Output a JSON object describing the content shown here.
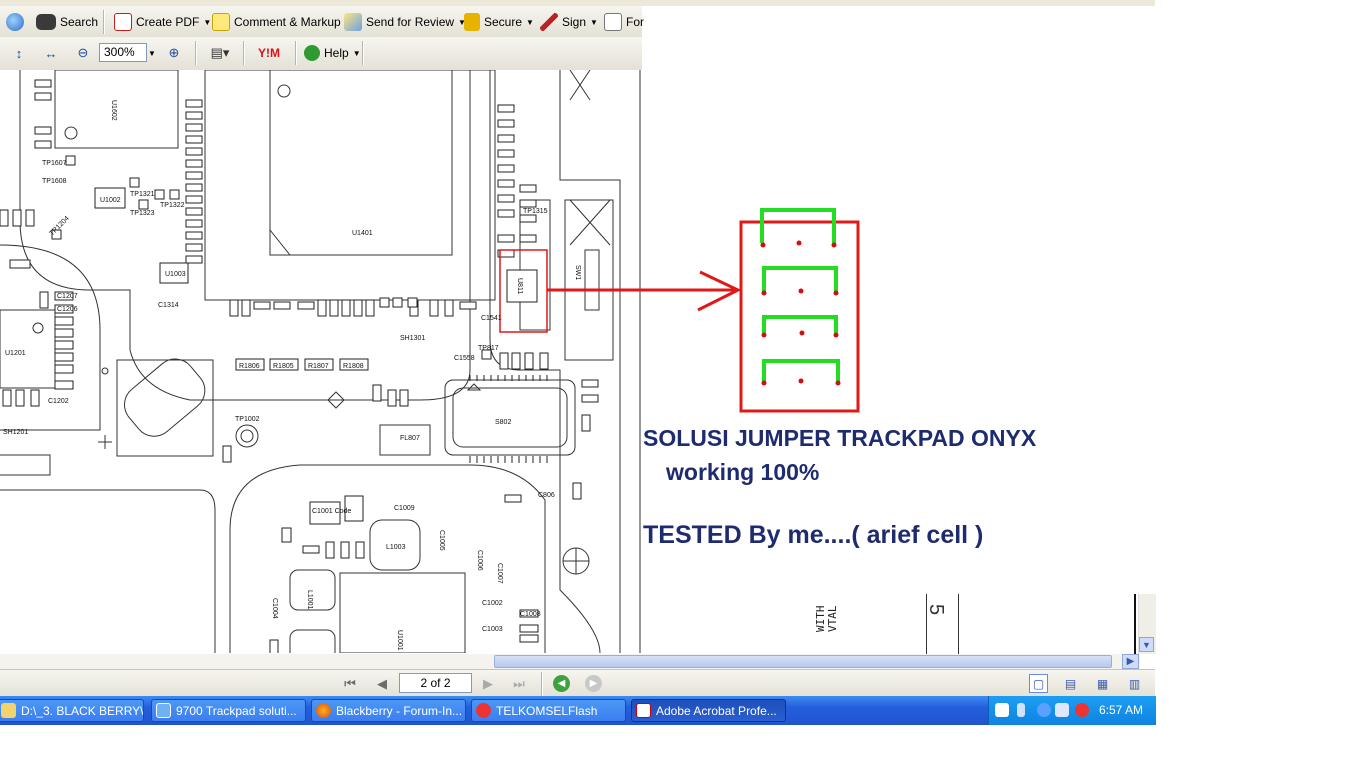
{
  "toolbar1": {
    "search_label": "Search",
    "create_pdf_label": "Create PDF",
    "comment_markup_label": "Comment & Markup",
    "send_review_label": "Send for Review",
    "secure_label": "Secure",
    "sign_label": "Sign",
    "forms_label": "For"
  },
  "toolbar2": {
    "zoom_value": "300%",
    "help_label": "Help",
    "yahoo_label": "Y!M"
  },
  "document": {
    "annotation_title": "SOLUSI JUMPER TRACKPAD ONYX",
    "annotation_line2": "working 100%",
    "annotation_line3": "TESTED By me....( arief cell )",
    "schematic_labels": {
      "u1401": "U1401",
      "u1602": "U1602",
      "u1002": "U1002",
      "u1003": "U1003",
      "u1201": "U1201",
      "c1314": "C1314",
      "sh1301": "SH1301",
      "sh1201": "SH1201",
      "s802": "S802",
      "l1003": "L1003",
      "l1001": "L1001",
      "c1001_code": "C1001 Code",
      "c1009": "C1009",
      "c1002": "C1002",
      "c1003": "C1003",
      "c806": "C806",
      "tp1002": "TP1002",
      "tp817": "TP817",
      "tp1607": "TP1607",
      "tp1608": "TP1608",
      "tp1204": "TP1204",
      "tp1321": "TP1321",
      "tp1322": "TP1322",
      "tp1323": "TP1323",
      "tp1315": "TP1315",
      "c1558": "C1558",
      "c1541": "C1541",
      "u811": "U811",
      "fl807": "FL807",
      "r1806": "R1806",
      "r1805": "R1805",
      "r1807": "R1807",
      "r1808": "R1808",
      "c1207": "C1207",
      "c1206": "C1206",
      "c1202": "C1202",
      "c1004": "C1004",
      "c1005": "C1005",
      "c1006": "C1006",
      "c1008": "C1008",
      "c1007": "C1007",
      "u1001": "U1001",
      "sw1": "SW1",
      "with_vtal": "WITH VTAL",
      "five": "5"
    }
  },
  "statusbar": {
    "page_value": "2 of 2"
  },
  "taskbar": {
    "tasks": [
      {
        "label": "D:\\_3. BLACK BERRY\\..."
      },
      {
        "label": "9700 Trackpad soluti..."
      },
      {
        "label": "Blackberry - Forum-In..."
      },
      {
        "label": "TELKOMSELFlash"
      },
      {
        "label": "Adobe Acrobat Profe..."
      }
    ],
    "clock": "6:57 AM"
  },
  "colors": {
    "annotation_red": "#e01818",
    "annotation_green": "#22dd22",
    "annotation_text": "#1e2b6e",
    "taskbar_blue": "#245edb"
  }
}
